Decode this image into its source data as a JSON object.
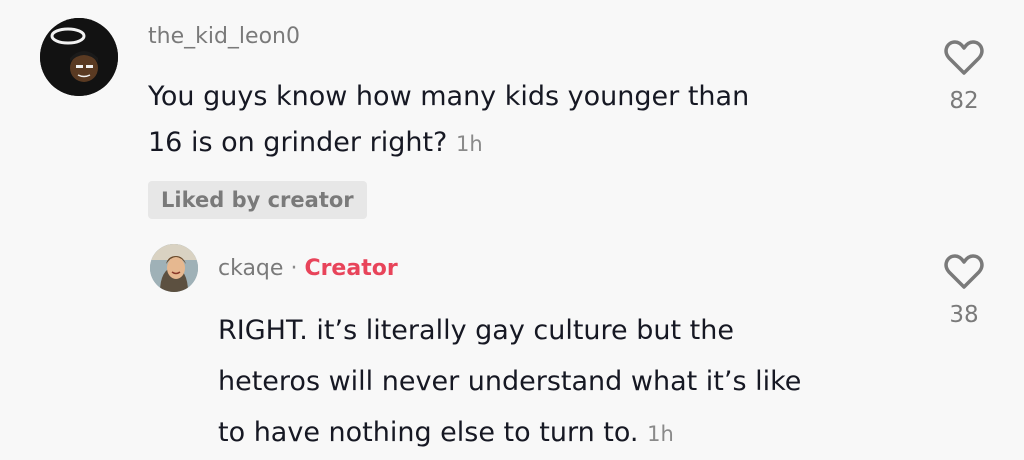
{
  "comment": {
    "username": "the_kid_leon0",
    "text_line1": "You guys know how many kids younger than",
    "text_line2": "16 is on grinder right?",
    "time": "1h",
    "likes": "82",
    "liked_badge": "Liked by creator",
    "avatar_icon": "avatar-halo-cartoon"
  },
  "reply": {
    "username": "ckaqe",
    "separator": "·",
    "creator_label": "Creator",
    "text_line1": "RIGHT. it’s literally gay culture but the",
    "text_line2": "heteros will never understand what it’s like",
    "text_line3": "to have nothing else to turn to.",
    "time": "1h",
    "likes": "38",
    "avatar_icon": "avatar-photo"
  },
  "colors": {
    "background": "#f8f8f8",
    "creator_accent": "#e8445a",
    "badge_bg": "#e7e7e7",
    "text": "#161823",
    "muted": "#7a7a7a"
  }
}
